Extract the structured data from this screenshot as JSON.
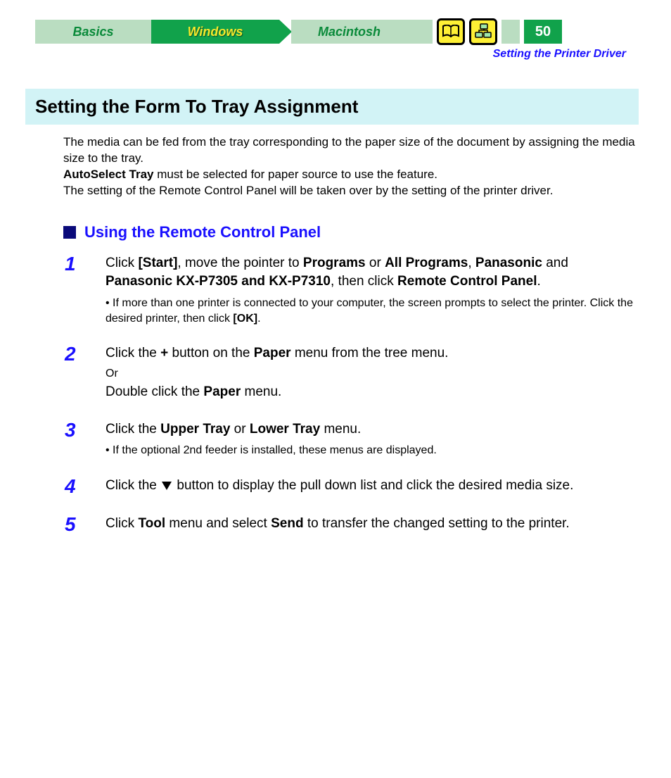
{
  "nav": {
    "basics": "Basics",
    "windows": "Windows",
    "macintosh": "Macintosh",
    "page_number": "50"
  },
  "breadcrumb": "Setting the Printer Driver",
  "title": "Setting the Form To Tray Assignment",
  "intro": {
    "p1": "The media can be fed from the tray corresponding to the paper size of the document by assigning the media size to the tray.",
    "p2a": "AutoSelect Tray",
    "p2b": " must be selected for paper source to use the feature.",
    "p3": "The setting of the Remote Control Panel will be taken over by the setting of the printer driver."
  },
  "subheading": "Using the Remote Control Panel",
  "steps": {
    "s1": {
      "num": "1",
      "t1": "Click ",
      "b1": "[Start]",
      "t2": ", move the pointer to ",
      "b2": "Programs",
      "t3": " or ",
      "b3": "All Programs",
      "t4": ", ",
      "b4": "Panasonic",
      "t5": " and ",
      "b5": "Panasonic KX-P7305 and KX-P7310",
      "t6": ", then click ",
      "b6": "Remote Control Panel",
      "t7": ".",
      "note_a": "• If more than one printer is connected to your computer, the screen prompts to select the printer. Click the desired printer, then click ",
      "note_b": "[OK]",
      "note_c": "."
    },
    "s2": {
      "num": "2",
      "t1": "Click the ",
      "b1": "+",
      "t2": " button on the ",
      "b2": "Paper",
      "t3": " menu from the tree menu.",
      "or": "Or",
      "t4": "Double click the ",
      "b3": "Paper",
      "t5": " menu."
    },
    "s3": {
      "num": "3",
      "t1": "Click the ",
      "b1": "Upper Tray",
      "t2": " or ",
      "b2": "Lower Tray",
      "t3": " menu.",
      "note": "• If the optional 2nd feeder is installed, these menus are displayed."
    },
    "s4": {
      "num": "4",
      "t1": "Click the ",
      "t2": " button to display the pull down list and click the desired media size."
    },
    "s5": {
      "num": "5",
      "t1": "Click ",
      "b1": "Tool",
      "t2": " menu and select ",
      "b2": "Send",
      "t3": " to transfer the changed setting to the printer."
    }
  }
}
